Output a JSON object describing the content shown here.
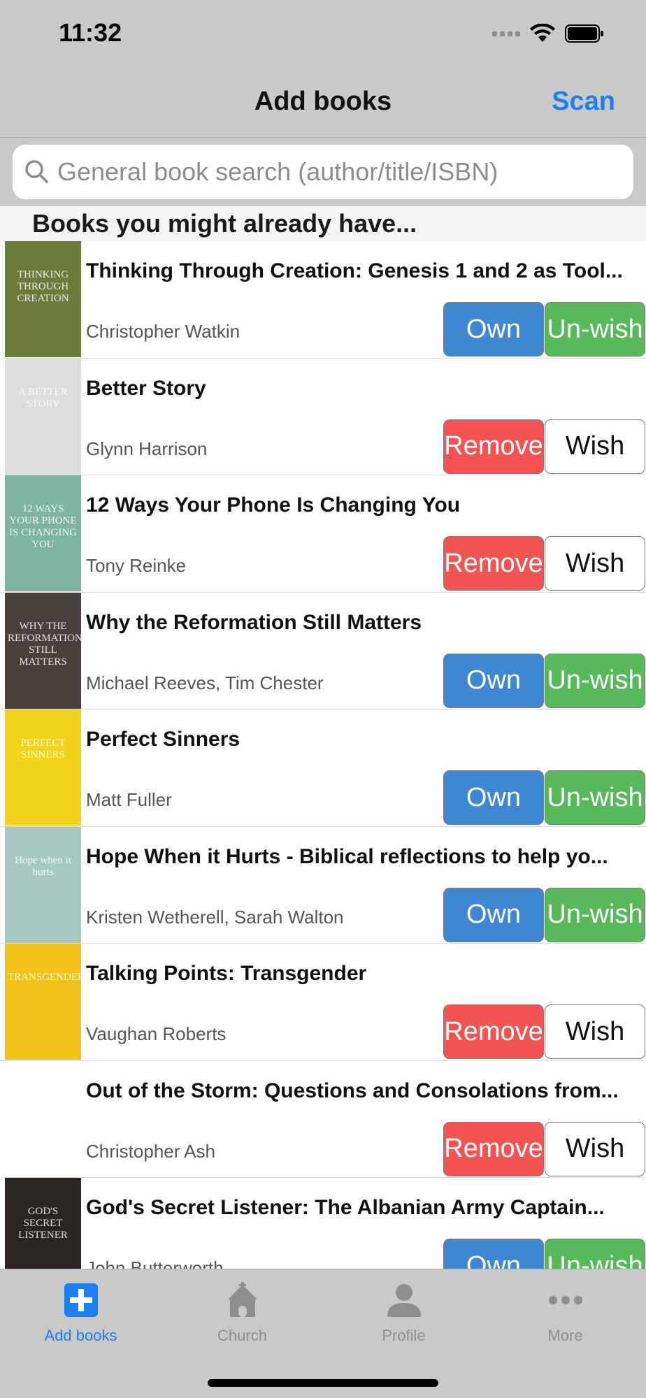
{
  "status_bar": {
    "time": "11:32"
  },
  "nav": {
    "title": "Add books",
    "scan_label": "Scan"
  },
  "search": {
    "placeholder": "General book search (author/title/ISBN)"
  },
  "section": {
    "title": "Books you might already have..."
  },
  "books": [
    {
      "title": "Thinking Through Creation: Genesis 1 and 2 as Tool...",
      "author": "Christopher Watkin",
      "cover_text": "THINKING THROUGH CREATION",
      "cover_color": "#6b7b3a",
      "left_label": "Own",
      "left_state": "own",
      "right_label": "Un-wish",
      "right_state": "unwish"
    },
    {
      "title": "Better Story",
      "author": "Glynn Harrison",
      "cover_text": "A BETTER STORY",
      "cover_color": "#dcdcdc",
      "left_label": "Remove",
      "left_state": "remove",
      "right_label": "Wish",
      "right_state": "wish"
    },
    {
      "title": "12 Ways Your Phone Is Changing You",
      "author": "Tony Reinke",
      "cover_text": "12 WAYS YOUR PHONE IS CHANGING YOU",
      "cover_color": "#7fb4a4",
      "left_label": "Remove",
      "left_state": "remove",
      "right_label": "Wish",
      "right_state": "wish"
    },
    {
      "title": "Why the Reformation Still Matters",
      "author": "Michael Reeves, Tim Chester",
      "cover_text": "WHY THE REFORMATION STILL MATTERS",
      "cover_color": "#4a3f3a",
      "left_label": "Own",
      "left_state": "own",
      "right_label": "Un-wish",
      "right_state": "unwish"
    },
    {
      "title": "Perfect Sinners",
      "author": "Matt Fuller",
      "cover_text": "PERFECT SINNERS",
      "cover_color": "#f3d21a",
      "left_label": "Own",
      "left_state": "own",
      "right_label": "Un-wish",
      "right_state": "unwish"
    },
    {
      "title": "Hope When it Hurts - Biblical reflections to help yo...",
      "author": "Kristen Wetherell, Sarah Walton",
      "cover_text": "Hope when it hurts",
      "cover_color": "#a8c8c4",
      "left_label": "Own",
      "left_state": "own",
      "right_label": "Un-wish",
      "right_state": "unwish"
    },
    {
      "title": "Talking Points: Transgender",
      "author": "Vaughan Roberts",
      "cover_text": "TRANSGENDER",
      "cover_color": "#f0c21a",
      "left_label": "Remove",
      "left_state": "remove",
      "right_label": "Wish",
      "right_state": "wish"
    },
    {
      "title": "Out of the Storm: Questions and Consolations from...",
      "author": "Christopher Ash",
      "cover_text": "",
      "cover_color": "#ffffff",
      "left_label": "Remove",
      "left_state": "remove",
      "right_label": "Wish",
      "right_state": "wish"
    },
    {
      "title": "God's Secret Listener: The Albanian Army Captain...",
      "author": "John Butterworth",
      "cover_text": "GOD'S SECRET LISTENER",
      "cover_color": "#2a2422",
      "left_label": "Own",
      "left_state": "own",
      "right_label": "Un-wish",
      "right_state": "unwish"
    }
  ],
  "tabs": [
    {
      "label": "Add books",
      "icon": "plus-icon",
      "active": true
    },
    {
      "label": "Church",
      "icon": "church-icon",
      "active": false
    },
    {
      "label": "Profile",
      "icon": "person-icon",
      "active": false
    },
    {
      "label": "More",
      "icon": "more-icon",
      "active": false
    }
  ],
  "colors": {
    "accent": "#1d7ff0",
    "own": "#3f88d1",
    "remove": "#f25353",
    "unwish": "#58b95a"
  }
}
